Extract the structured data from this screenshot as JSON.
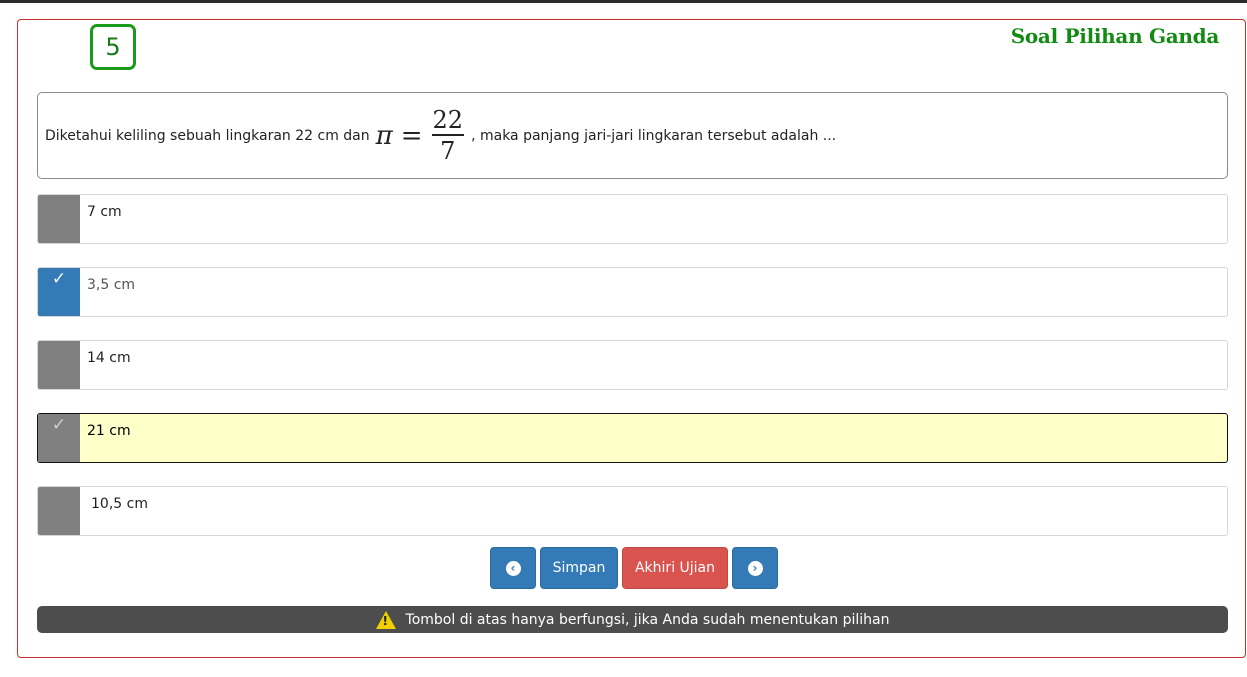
{
  "question_number": "5",
  "heading": "Soal Pilihan Ganda",
  "question": {
    "text_before": "Diketahui keliling sebuah lingkaran 22 cm dan",
    "math": {
      "symbol": "π",
      "equals": "=",
      "numerator": "22",
      "denominator": "7"
    },
    "text_after": ", maka panjang jari-jari lingkaran tersebut adalah ..."
  },
  "options": [
    {
      "label": "7 cm",
      "state": "normal"
    },
    {
      "label": "3,5 cm",
      "state": "selected",
      "check": "✓"
    },
    {
      "label": "14 cm",
      "state": "normal"
    },
    {
      "label": "21 cm",
      "state": "highlighted",
      "check": "✓"
    },
    {
      "label": "10,5 cm",
      "state": "normal"
    }
  ],
  "buttons": {
    "prev_icon": "chevron-left-circle-icon",
    "save_label": "Simpan",
    "end_label": "Akhiri Ujian",
    "next_icon": "chevron-right-circle-icon"
  },
  "notice": {
    "icon": "warning-icon",
    "text": "Tombol di atas hanya berfungsi, jika Anda sudah menentukan pilihan"
  },
  "colors": {
    "accent_green": "#138a13",
    "border_red": "#c9302c",
    "primary_blue": "#337ab7",
    "danger_red": "#d9534f",
    "marker_gray": "#808080",
    "highlight_yellow": "#ffffc9",
    "notice_bg": "#4d4d4d"
  }
}
